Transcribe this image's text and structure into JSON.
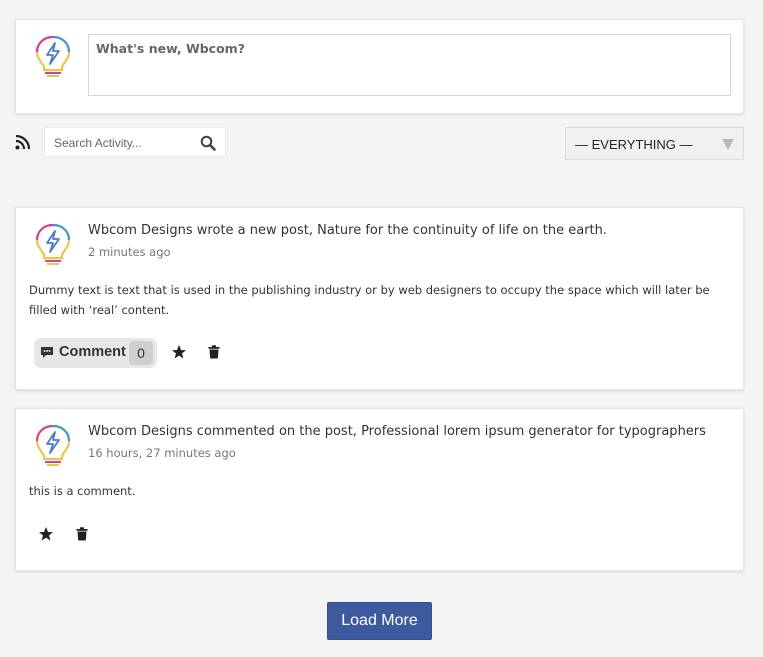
{
  "post_form": {
    "placeholder": "What's new, Wbcom?"
  },
  "filters": {
    "search_placeholder": "Search Activity...",
    "select_value": "— EVERYTHING —"
  },
  "activities": [
    {
      "header": "Wbcom Designs wrote a new post, Nature for the continuity of life on the earth.",
      "time": "2 minutes ago",
      "content": "Dummy text is text that is used in the publishing industry or by web designers to occupy the space which will later be filled with ‘real’ content.",
      "comment_label": "Comment",
      "comment_count": "0"
    },
    {
      "header": "Wbcom Designs commented on the post, Professional lorem ipsum generator for typographers",
      "time": "16 hours, 27 minutes ago",
      "content": "this is a comment."
    }
  ],
  "load_more_label": "Load More",
  "icons": {
    "rss": "rss-icon",
    "search": "search-icon",
    "comment": "comment-bubble-icon",
    "star": "star-icon",
    "trash": "trash-icon",
    "avatar": "lightbulb-avatar"
  },
  "colors": {
    "accent": "#3d5a9e",
    "rss": "#222222",
    "page_bg": "#f4f4f4"
  }
}
